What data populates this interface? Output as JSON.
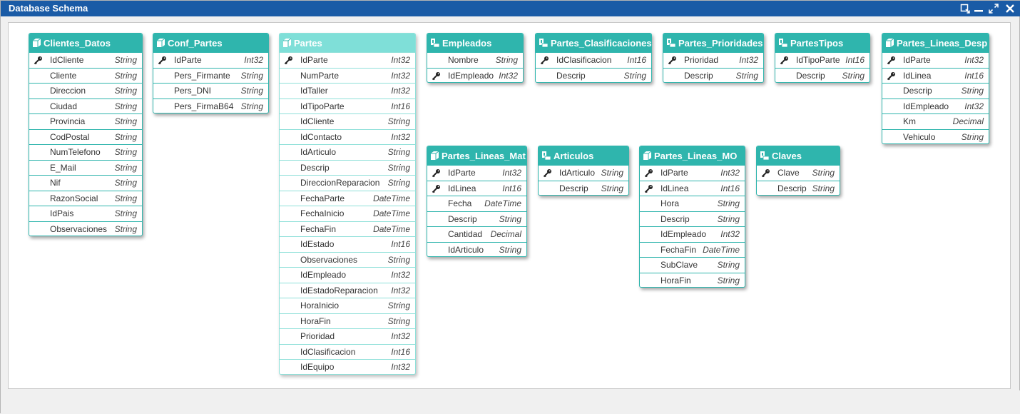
{
  "window": {
    "title": "Database Schema"
  },
  "colors": {
    "header": "#2fb5ad",
    "selected_header": "#7fdfd8",
    "titlebar": "#1a5ba6"
  },
  "tables": [
    {
      "name": "Clientes_Datos",
      "icon": "table-icon",
      "fields": [
        {
          "name": "IdCliente",
          "type": "String",
          "key": true
        },
        {
          "name": "Cliente",
          "type": "String"
        },
        {
          "name": "Direccion",
          "type": "String"
        },
        {
          "name": "Ciudad",
          "type": "String"
        },
        {
          "name": "Provincia",
          "type": "String"
        },
        {
          "name": "CodPostal",
          "type": "String"
        },
        {
          "name": "NumTelefono",
          "type": "String"
        },
        {
          "name": "E_Mail",
          "type": "String"
        },
        {
          "name": "Nif",
          "type": "String"
        },
        {
          "name": "RazonSocial",
          "type": "String"
        },
        {
          "name": "IdPais",
          "type": "String"
        },
        {
          "name": "Observaciones",
          "type": "String"
        }
      ]
    },
    {
      "name": "Conf_Partes",
      "icon": "table-icon",
      "fields": [
        {
          "name": "IdParte",
          "type": "Int32",
          "key": true
        },
        {
          "name": "Pers_Firmante",
          "type": "String"
        },
        {
          "name": "Pers_DNI",
          "type": "String"
        },
        {
          "name": "Pers_FirmaB64",
          "type": "String"
        }
      ]
    },
    {
      "name": "Partes",
      "icon": "table-icon",
      "selected": true,
      "fields": [
        {
          "name": "IdParte",
          "type": "Int32",
          "key": true
        },
        {
          "name": "NumParte",
          "type": "Int32"
        },
        {
          "name": "IdTaller",
          "type": "Int32"
        },
        {
          "name": "IdTipoParte",
          "type": "Int16"
        },
        {
          "name": "IdCliente",
          "type": "String"
        },
        {
          "name": "IdContacto",
          "type": "Int32"
        },
        {
          "name": "IdArticulo",
          "type": "String"
        },
        {
          "name": "Descrip",
          "type": "String"
        },
        {
          "name": "DireccionReparacion",
          "type": "String"
        },
        {
          "name": "FechaParte",
          "type": "DateTime"
        },
        {
          "name": "FechaInicio",
          "type": "DateTime"
        },
        {
          "name": "FechaFin",
          "type": "DateTime"
        },
        {
          "name": "IdEstado",
          "type": "Int16"
        },
        {
          "name": "Observaciones",
          "type": "String"
        },
        {
          "name": "IdEmpleado",
          "type": "Int32"
        },
        {
          "name": "IdEstadoReparacion",
          "type": "Int32"
        },
        {
          "name": "HoraInicio",
          "type": "String"
        },
        {
          "name": "HoraFin",
          "type": "String"
        },
        {
          "name": "Prioridad",
          "type": "Int32"
        },
        {
          "name": "IdClasificacion",
          "type": "Int16"
        },
        {
          "name": "IdEquipo",
          "type": "Int32"
        }
      ]
    },
    {
      "name": "Empleados",
      "icon": "view-icon",
      "fields": [
        {
          "name": "Nombre",
          "type": "String"
        },
        {
          "name": "IdEmpleado",
          "type": "Int32",
          "key": true
        }
      ]
    },
    {
      "name": "Partes_Clasificaciones",
      "icon": "view-icon",
      "fields": [
        {
          "name": "IdClasificacion",
          "type": "Int16",
          "key": true
        },
        {
          "name": "Descrip",
          "type": "String"
        }
      ]
    },
    {
      "name": "Partes_Prioridades",
      "icon": "view-icon",
      "fields": [
        {
          "name": "Prioridad",
          "type": "Int32",
          "key": true
        },
        {
          "name": "Descrip",
          "type": "String"
        }
      ]
    },
    {
      "name": "PartesTipos",
      "icon": "view-icon",
      "fields": [
        {
          "name": "IdTipoParte",
          "type": "Int16",
          "key": true
        },
        {
          "name": "Descrip",
          "type": "String"
        }
      ]
    },
    {
      "name": "Partes_Lineas_Desp",
      "icon": "table-icon",
      "fields": [
        {
          "name": "IdParte",
          "type": "Int32",
          "key": true
        },
        {
          "name": "IdLinea",
          "type": "Int16",
          "key": true
        },
        {
          "name": "Descrip",
          "type": "String"
        },
        {
          "name": "IdEmpleado",
          "type": "Int32"
        },
        {
          "name": "Km",
          "type": "Decimal"
        },
        {
          "name": "Vehiculo",
          "type": "String"
        }
      ]
    },
    {
      "name": "Partes_Lineas_Mat",
      "icon": "table-icon",
      "fields": [
        {
          "name": "IdParte",
          "type": "Int32",
          "key": true
        },
        {
          "name": "IdLinea",
          "type": "Int16",
          "key": true
        },
        {
          "name": "Fecha",
          "type": "DateTime"
        },
        {
          "name": "Descrip",
          "type": "String"
        },
        {
          "name": "Cantidad",
          "type": "Decimal"
        },
        {
          "name": "IdArticulo",
          "type": "String"
        }
      ]
    },
    {
      "name": "Articulos",
      "icon": "view-icon",
      "fields": [
        {
          "name": "IdArticulo",
          "type": "String",
          "key": true
        },
        {
          "name": "Descrip",
          "type": "String"
        }
      ]
    },
    {
      "name": "Partes_Lineas_MO",
      "icon": "table-icon",
      "fields": [
        {
          "name": "IdParte",
          "type": "Int32",
          "key": true
        },
        {
          "name": "IdLinea",
          "type": "Int16",
          "key": true
        },
        {
          "name": "Hora",
          "type": "String"
        },
        {
          "name": "Descrip",
          "type": "String"
        },
        {
          "name": "IdEmpleado",
          "type": "Int32"
        },
        {
          "name": "FechaFin",
          "type": "DateTime"
        },
        {
          "name": "SubClave",
          "type": "String"
        },
        {
          "name": "HoraFin",
          "type": "String"
        }
      ]
    },
    {
      "name": "Claves",
      "icon": "view-icon",
      "fields": [
        {
          "name": "Clave",
          "type": "String",
          "key": true
        },
        {
          "name": "Descrip",
          "type": "String"
        }
      ]
    }
  ]
}
